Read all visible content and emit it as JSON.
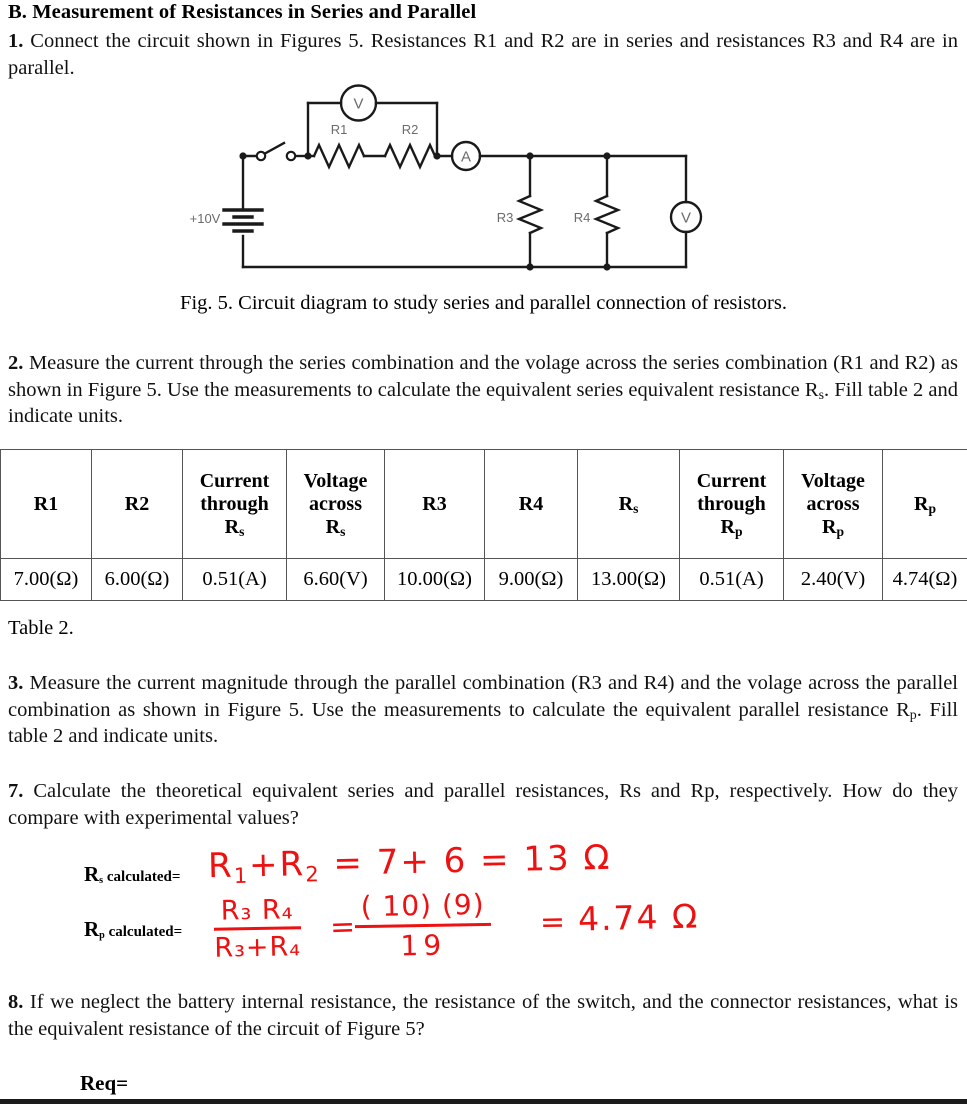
{
  "section": {
    "heading": "B. Measurement of Resistances in Series and Parallel"
  },
  "items": {
    "item1": {
      "number": "1.",
      "text": "Connect the circuit shown in Figures 5.  Resistances R1 and R2 are in series and resistances R3 and R4 are in parallel."
    },
    "item2": {
      "number": "2.",
      "text_part1": "Measure the current through the series combination and the volage across the series combination (R1 and R2) as shown in Figure 5.  Use the measurements to calculate the equivalent series equivalent resistance R",
      "sub": "s",
      "text_part2": ".  Fill table 2 and indicate units."
    },
    "item3": {
      "number": "3.",
      "text_part1": "Measure the current magnitude through the parallel combination (R3 and R4) and the volage across the parallel combination as shown in Figure 5.  Use the measurements to calculate the equivalent parallel resistance R",
      "sub": "p",
      "text_part2": ".  Fill table 2 and indicate units."
    },
    "item7": {
      "number": "7.",
      "text": "Calculate the theoretical equivalent series and parallel resistances, Rs and Rp, respectively. How do they compare with experimental values?"
    },
    "item8": {
      "number": "8.",
      "text": "If we neglect the battery internal resistance, the resistance of the switch, and the connector resistances, what is the equivalent resistance of the circuit of Figure 5?"
    }
  },
  "figure": {
    "caption": "Fig. 5.  Circuit diagram to study series and parallel connection of resistors.",
    "labels": {
      "source": "+10V",
      "r1": "R1",
      "r2": "R2",
      "r3": "R3",
      "r4": "R4",
      "voltmeter_series": "V",
      "ammeter": "A",
      "voltmeter_parallel": "V"
    },
    "line_color": "#1a1a1a",
    "label_color": "#6b6b6b"
  },
  "table": {
    "caption": "Table 2.",
    "headers": [
      {
        "line1": "R1",
        "line2": "",
        "sub": ""
      },
      {
        "line1": "R2",
        "line2": "",
        "sub": ""
      },
      {
        "line1": "Current",
        "line2": "through",
        "sub": "s"
      },
      {
        "line1": "Voltage",
        "line2": "across",
        "sub": "s"
      },
      {
        "line1": "R3",
        "line2": "",
        "sub": ""
      },
      {
        "line1": "R4",
        "line2": "",
        "sub": ""
      },
      {
        "line1": "R",
        "line2": "",
        "sub": "s"
      },
      {
        "line1": "Current",
        "line2": "through",
        "sub": "p"
      },
      {
        "line1": "Voltage",
        "line2": "across",
        "sub": "p"
      },
      {
        "line1": "R",
        "line2": "",
        "sub": "p"
      }
    ],
    "row": [
      "7.00(Ω)",
      "6.00(Ω)",
      "0.51(A)",
      "6.60(V)",
      "10.00(Ω)",
      "9.00(Ω)",
      "13.00(Ω)",
      "0.51(A)",
      "2.40(V)",
      "4.74(Ω)"
    ]
  },
  "answers": {
    "rs_label_r": "R",
    "rs_label_sub": "s",
    "rs_label_rest": " calculated=",
    "rp_label_r": "R",
    "rp_label_sub": "p",
    "rp_label_rest": " calculated=",
    "rs_handwritten": "R₁ + R₂ = 7 + 6 = 13 Ω",
    "rs_hw_lhs": "R",
    "rs_hw_sub1": "1",
    "rs_hw_plus": "+R",
    "rs_hw_sub2": "2",
    "rs_hw_rhs": "= 7+ 6 = 13",
    "rs_hw_unit": "Ω",
    "rp_hw_num": "R₃ R₄",
    "rp_hw_den": "R₃+R₄",
    "rp_hw_eq1": "=",
    "rp_hw_num2": "( 10) (9)",
    "rp_hw_den2": "19",
    "rp_hw_eq2": "=",
    "rp_hw_result": "4.74 Ω",
    "req_label": "Req=",
    "ink_color": "#ee1111"
  }
}
